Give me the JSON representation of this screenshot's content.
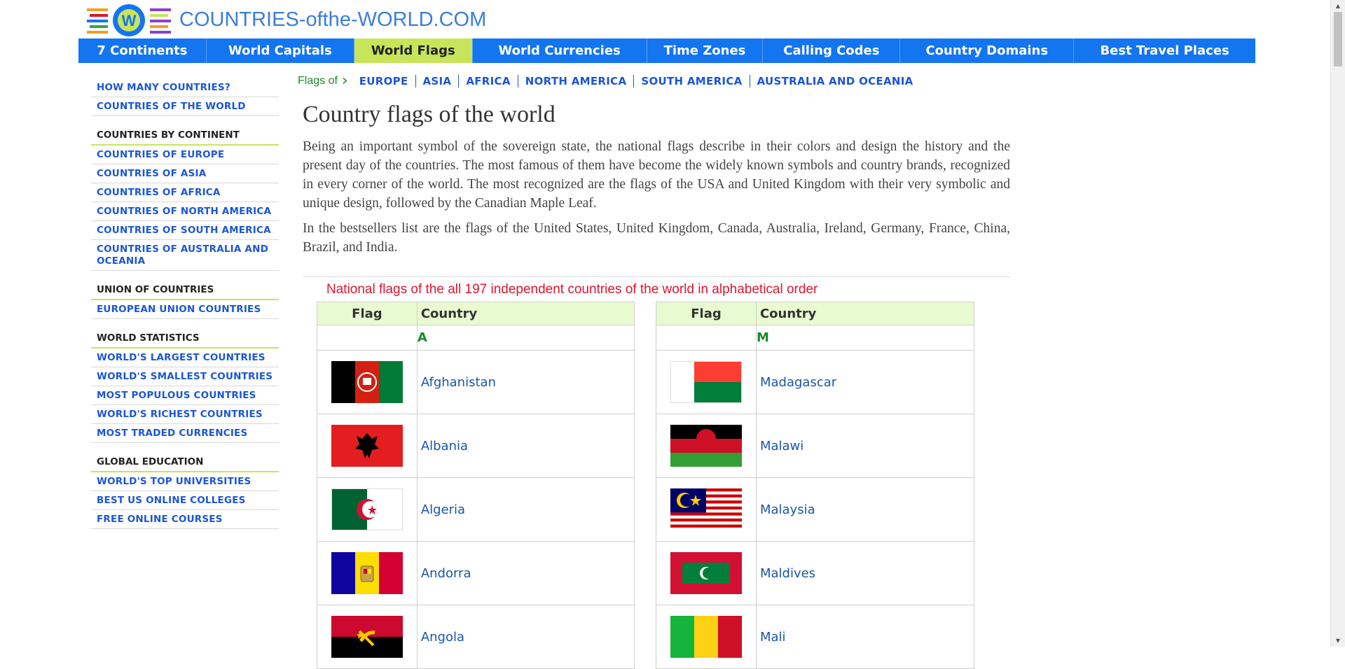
{
  "site": {
    "title": "COUNTRIES-ofthe-WORLD.COM"
  },
  "nav": [
    {
      "label": "7 Continents"
    },
    {
      "label": "World Capitals"
    },
    {
      "label": "World Flags",
      "active": true
    },
    {
      "label": "World Currencies"
    },
    {
      "label": "Time Zones"
    },
    {
      "label": "Calling Codes"
    },
    {
      "label": "Country Domains"
    },
    {
      "label": "Best Travel Places"
    }
  ],
  "sidebar": {
    "links1": [
      "HOW MANY COUNTRIES?",
      "COUNTRIES OF THE WORLD"
    ],
    "continent_head": "COUNTRIES BY CONTINENT",
    "continent_links": [
      "COUNTRIES OF EUROPE",
      "COUNTRIES OF ASIA",
      "COUNTRIES OF AFRICA",
      "COUNTRIES OF NORTH AMERICA",
      "COUNTRIES OF SOUTH AMERICA",
      "COUNTRIES OF AUSTRALIA AND OCEANIA"
    ],
    "union_head": "UNION OF COUNTRIES",
    "union_links": [
      "EUROPEAN UNION COUNTRIES"
    ],
    "stats_head": "WORLD STATISTICS",
    "stats_links": [
      "WORLD'S LARGEST COUNTRIES",
      "WORLD'S SMALLEST COUNTRIES",
      "MOST POPULOUS COUNTRIES",
      "WORLD'S RICHEST COUNTRIES",
      "MOST TRADED CURRENCIES"
    ],
    "edu_head": "GLOBAL EDUCATION",
    "edu_links": [
      "WORLD'S TOP UNIVERSITIES",
      "BEST US ONLINE COLLEGES",
      "FREE ONLINE COURSES"
    ]
  },
  "breadcrumb": {
    "label": "Flags of",
    "items": [
      "EUROPE",
      "ASIA",
      "AFRICA",
      "NORTH AMERICA",
      "SOUTH AMERICA",
      "AUSTRALIA AND OCEANIA"
    ]
  },
  "main": {
    "title": "Country flags of the world",
    "para1": "Being an important symbol of the sovereign state, the national flags describe in their colors and design the history and the present day of the countries. The most famous of them have become the widely known symbols and country brands, recognized in every corner of the world. The most recognized are the flags of the USA and United Kingdom with their very symbolic and unique design, followed by the Canadian Maple Leaf.",
    "para2": "In the bestsellers list are the flags of the United States, United Kingdom, Canada, Australia, Ireland, Germany, France, China, Brazil, and India.",
    "table_title": "National flags of the all 197 independent countries of the world in alphabetical order"
  },
  "tables": {
    "col_flag": "Flag",
    "col_country": "Country",
    "left": {
      "letter": "A",
      "countries": [
        "Afghanistan",
        "Albania",
        "Algeria",
        "Andorra",
        "Angola"
      ],
      "flags": [
        "flag-afghanistan-icon",
        "flag-albania-icon",
        "flag-algeria-icon",
        "flag-andorra-icon",
        "flag-angola-icon"
      ]
    },
    "right": {
      "letter": "M",
      "countries": [
        "Madagascar",
        "Malawi",
        "Malaysia",
        "Maldives",
        "Mali"
      ],
      "flags": [
        "flag-madagascar-icon",
        "flag-malawi-icon",
        "flag-malaysia-icon",
        "flag-maldives-icon",
        "flag-mali-icon"
      ]
    }
  },
  "colors": {
    "nav_bg": "#1475f0",
    "nav_active": "#c8e45a",
    "link": "#1a56d6",
    "accent_red": "#e0152f",
    "accent_green": "#1a8a2a",
    "table_header_bg": "#e8fbd0"
  }
}
